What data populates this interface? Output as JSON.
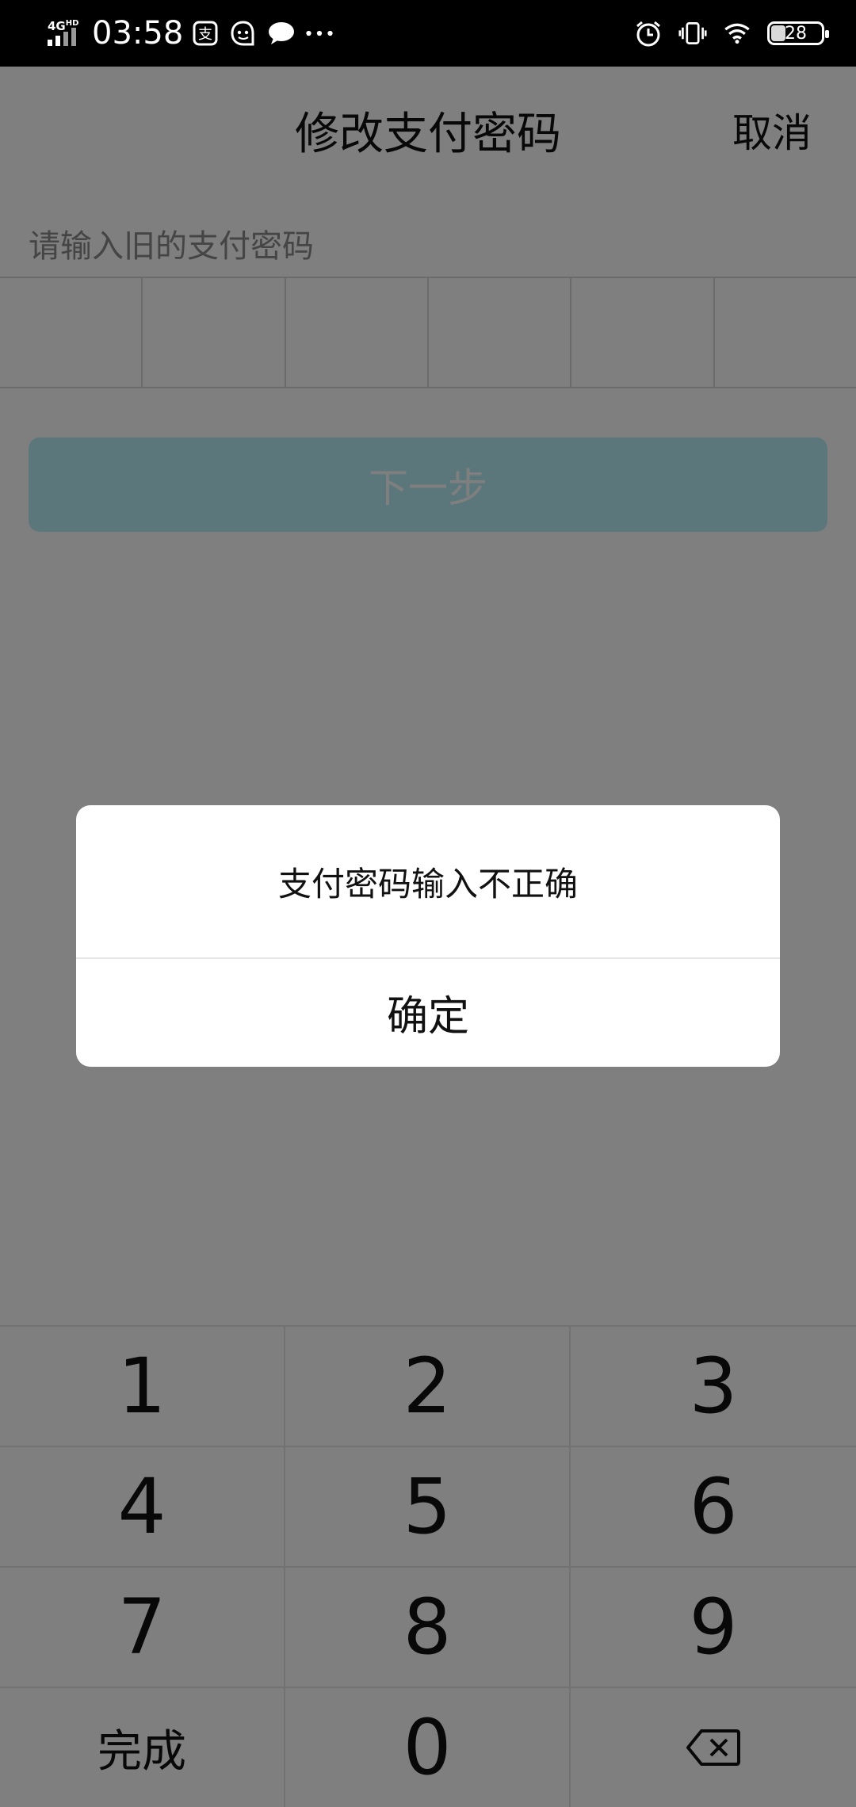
{
  "status_bar": {
    "network": "4G",
    "network_sub": "HD",
    "time": "03:58",
    "battery": "28",
    "icons": [
      "alipay-icon",
      "qq-icon",
      "chat-bubble-icon",
      "more-dots-icon",
      "alarm-icon",
      "vibrate-icon",
      "wifi-icon",
      "battery-icon"
    ]
  },
  "header": {
    "title": "修改支付密码",
    "cancel_label": "取消"
  },
  "form": {
    "prompt": "请输入旧的支付密码",
    "pin_length": 6,
    "next_label": "下一步",
    "next_color": "#b7eef6"
  },
  "dialog": {
    "message": "支付密码输入不正确",
    "confirm_label": "确定"
  },
  "keypad": {
    "keys": [
      "1",
      "2",
      "3",
      "4",
      "5",
      "6",
      "7",
      "8",
      "9",
      "完成",
      "0",
      "⌫"
    ]
  }
}
